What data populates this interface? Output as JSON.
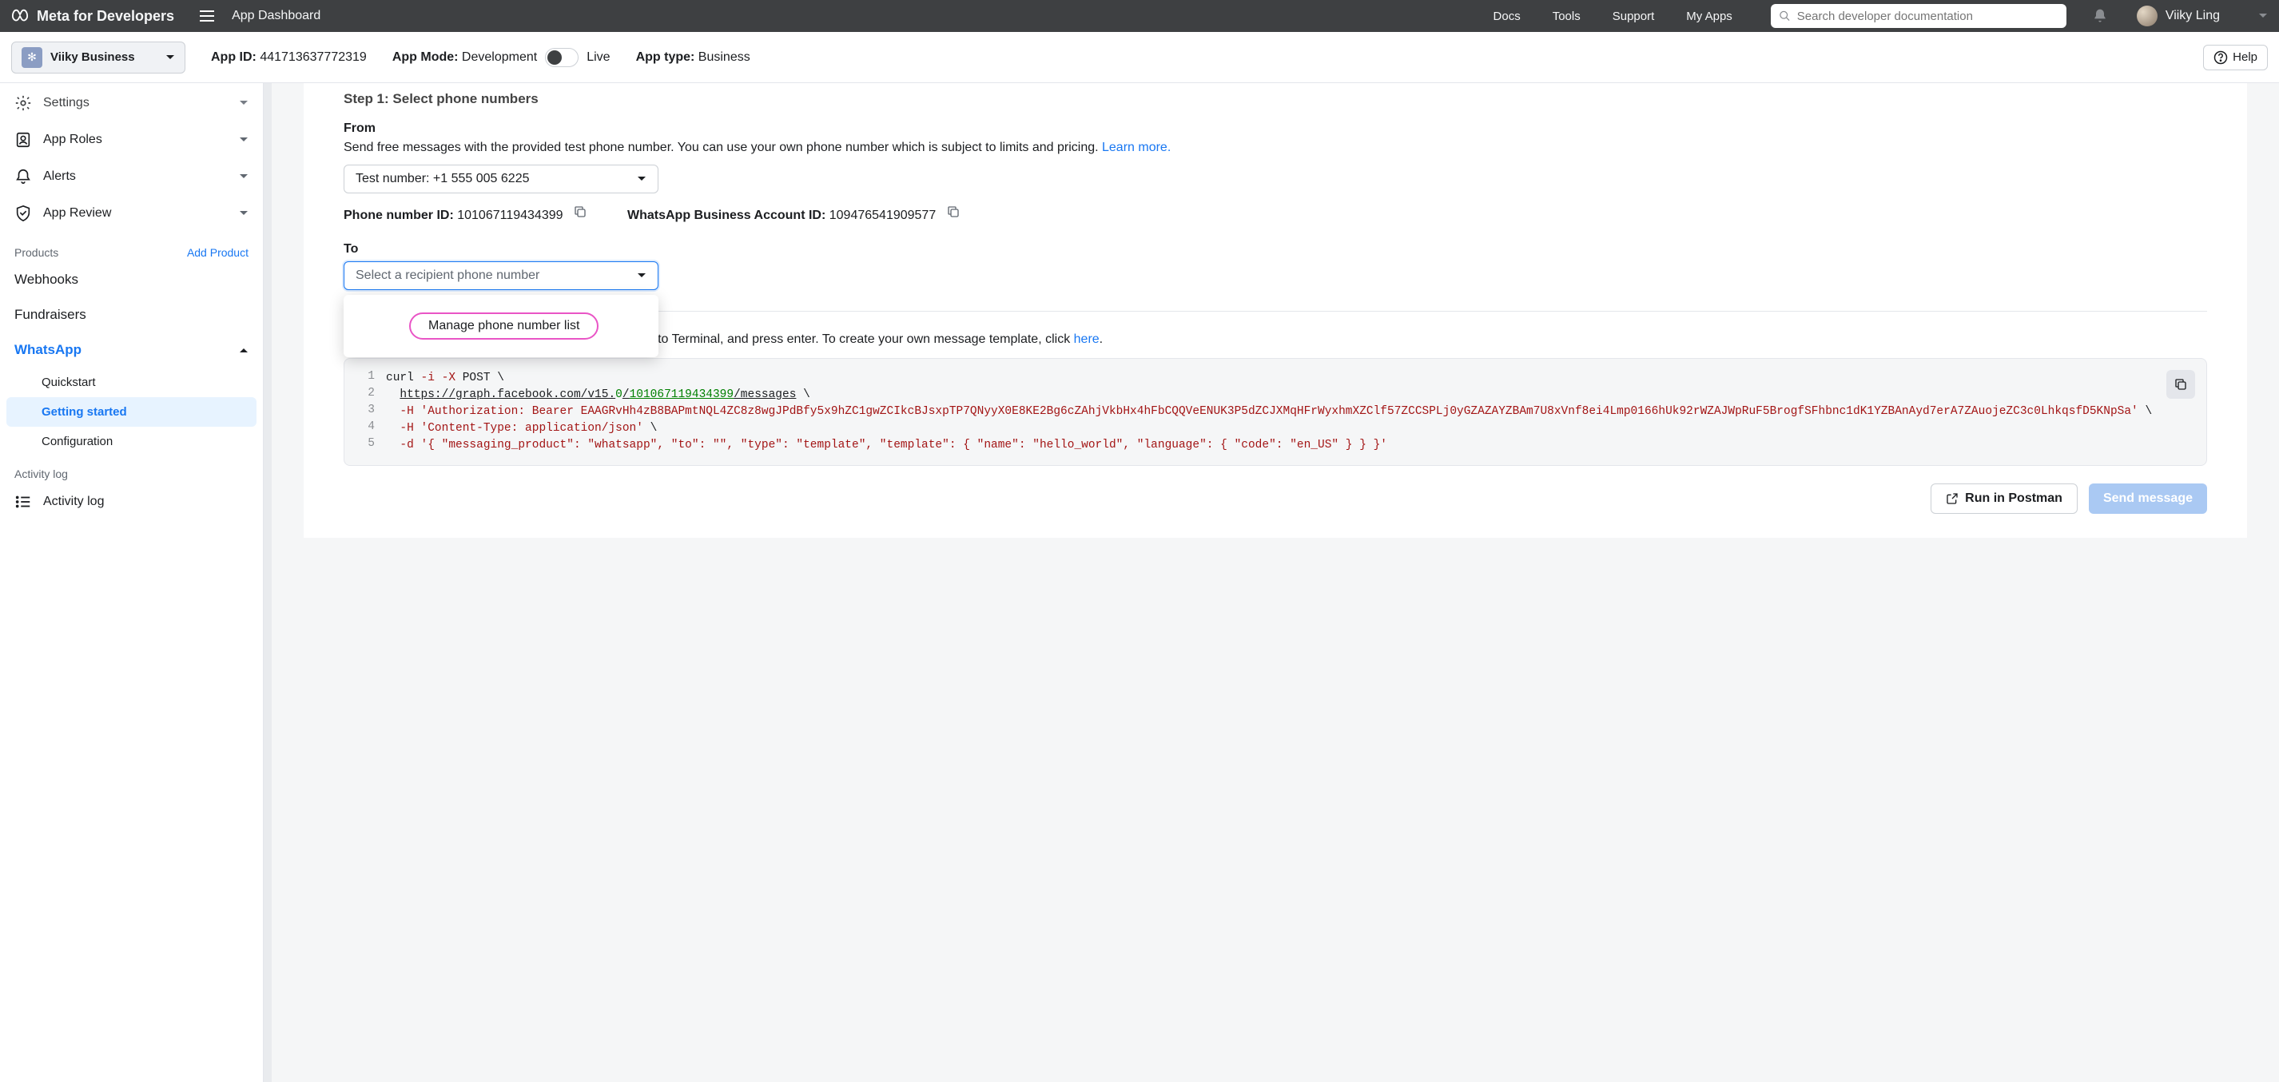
{
  "topbar": {
    "brand": "Meta for Developers",
    "dashboard": "App Dashboard",
    "nav": {
      "docs": "Docs",
      "tools": "Tools",
      "support": "Support",
      "myapps": "My Apps"
    },
    "search_placeholder": "Search developer documentation",
    "username": "Viiky Ling"
  },
  "secondary": {
    "app_name": "Viiky Business",
    "appid_label": "App ID:",
    "appid_value": "441713637772319",
    "mode_label": "App Mode:",
    "mode_dev": "Development",
    "mode_live": "Live",
    "type_label": "App type:",
    "type_value": "Business",
    "help": "Help"
  },
  "sidebar": {
    "settings": "Settings",
    "approles": "App Roles",
    "alerts": "Alerts",
    "appreview": "App Review",
    "products_label": "Products",
    "add_product": "Add Product",
    "webhooks": "Webhooks",
    "fundraisers": "Fundraisers",
    "whatsapp": "WhatsApp",
    "wa_quickstart": "Quickstart",
    "wa_getting": "Getting started",
    "wa_config": "Configuration",
    "activity_heading": "Activity log",
    "activity_log": "Activity log"
  },
  "content": {
    "step1_title": "Step 1: Select phone numbers",
    "from_label": "From",
    "from_help_a": "Send free messages with the provided test phone number. You can use your own phone number which is subject to limits and pricing. ",
    "from_help_link": "Learn more.",
    "from_value": "Test number: +1 555 005 6225",
    "pn_id_label": "Phone number ID:",
    "pn_id_value": "101067119434399",
    "waba_label": "WhatsApp Business Account ID:",
    "waba_value": "109476541909577",
    "to_label": "To",
    "to_placeholder": "Select a recipient phone number",
    "manage": "Manage phone number list",
    "step2_a": "To send a test message, copy this command, paste it into Terminal, and press enter. To create your own message template, click ",
    "step2_link": "here",
    "step2_b": ".",
    "code": {
      "ln1": "1",
      "ln2": "2",
      "ln3": "3",
      "ln4": "4",
      "ln5": "5",
      "l1_a": "curl ",
      "l1_b": "-i ",
      "l1_c": "-X",
      "l1_d": " POST \\",
      "l2_a": "  ",
      "l2_b": "https://graph.facebook.com/v15.",
      "l2_c": "0",
      "l2_d": "/",
      "l2_e": "101067119434399",
      "l2_f": "/messages",
      "l2_g": " \\",
      "l3_a": "  ",
      "l3_b": "-H",
      "l3_c": " 'Authorization: Bearer EAAGRvHh4zB8BAPmtNQL4ZC8z8wgJPdBfy5x9hZC1gwZCIkcBJsxpTP7QNyyX0E8KE2Bg6cZAhjVkbHx4hFbCQQVeENUK3P5dZCJXMqHFrWyxhmXZClf57ZCCSPLj0yGZAZAYZBAm7U8xVnf8ei4Lmp0166hUk92rWZAJWpRuF5BrogfSFhbnc1dK1YZBAnAyd7erA7ZAuojeZC3c0LhkqsfD5KNpSa'",
      "l3_d": " \\",
      "l4_a": "  ",
      "l4_b": "-H",
      "l4_c": " 'Content-Type: application/json'",
      "l4_d": " \\",
      "l5_a": "  ",
      "l5_b": "-d",
      "l5_c": " '{ \"messaging_product\": \"whatsapp\", \"to\": \"\", \"type\": \"template\", \"template\": { \"name\": \"hello_world\", \"language\": { \"code\": \"en_US\" } } }'"
    },
    "run_postman": "Run in Postman",
    "send_msg": "Send message"
  }
}
